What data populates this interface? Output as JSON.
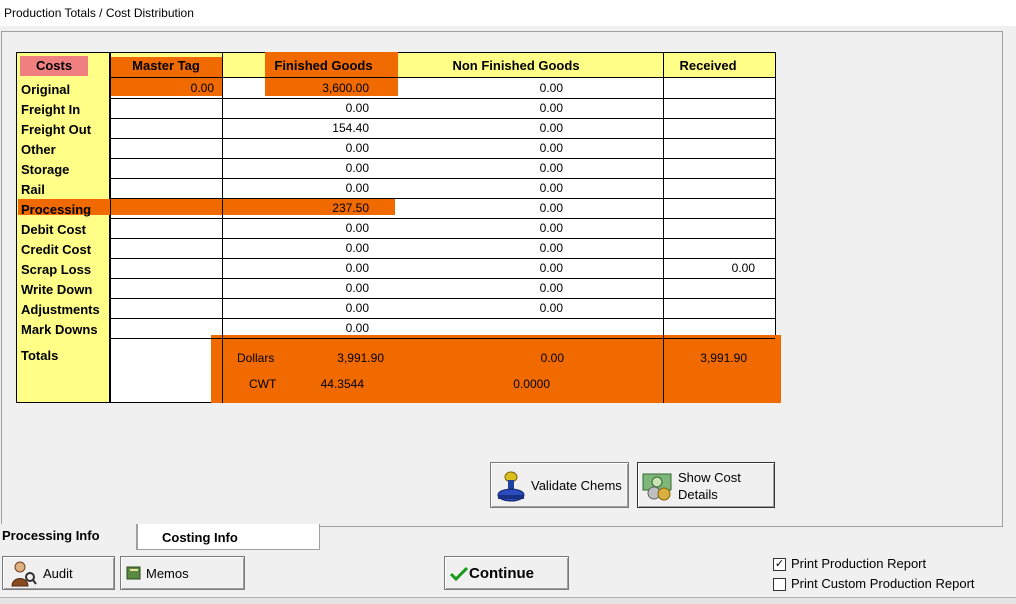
{
  "window": {
    "title": "Production Totals / Cost Distribution"
  },
  "headers": {
    "costs": "Costs",
    "master_tag": "Master Tag",
    "finished_goods": "Finished Goods",
    "non_finished_goods": "Non Finished Goods",
    "received": "Received"
  },
  "rows": [
    {
      "label": "Original",
      "master": "0.00",
      "fg": "3,600.00",
      "nfg": "0.00",
      "rec": ""
    },
    {
      "label": "Freight In",
      "master": "",
      "fg": "0.00",
      "nfg": "0.00",
      "rec": ""
    },
    {
      "label": "Freight Out",
      "master": "",
      "fg": "154.40",
      "nfg": "0.00",
      "rec": ""
    },
    {
      "label": "Other",
      "master": "",
      "fg": "0.00",
      "nfg": "0.00",
      "rec": ""
    },
    {
      "label": "Storage",
      "master": "",
      "fg": "0.00",
      "nfg": "0.00",
      "rec": ""
    },
    {
      "label": "Rail",
      "master": "",
      "fg": "0.00",
      "nfg": "0.00",
      "rec": ""
    },
    {
      "label": "Processing",
      "master": "",
      "fg": "237.50",
      "nfg": "0.00",
      "rec": ""
    },
    {
      "label": "Debit Cost",
      "master": "",
      "fg": "0.00",
      "nfg": "0.00",
      "rec": ""
    },
    {
      "label": "Credit Cost",
      "master": "",
      "fg": "0.00",
      "nfg": "0.00",
      "rec": ""
    },
    {
      "label": "Scrap Loss",
      "master": "",
      "fg": "0.00",
      "nfg": "0.00",
      "rec": "0.00"
    },
    {
      "label": "Write Down",
      "master": "",
      "fg": "0.00",
      "nfg": "0.00",
      "rec": ""
    },
    {
      "label": "Adjustments",
      "master": "",
      "fg": "0.00",
      "nfg": "0.00",
      "rec": ""
    },
    {
      "label": "Mark Downs",
      "master": "",
      "fg": "0.00",
      "nfg": "",
      "rec": ""
    }
  ],
  "totals": {
    "label": "Totals",
    "dollars_label": "Dollars",
    "dollars_fg": "3,991.90",
    "dollars_nfg": "0.00",
    "dollars_rec": "3,991.90",
    "cwt_label": "CWT",
    "cwt_fg": "44.3544",
    "cwt_nfg": "0.0000"
  },
  "buttons": {
    "validate_chems": "Validate Chems",
    "show_cost_details_1": "Show Cost",
    "show_cost_details_2": "Details",
    "audit": "Audit",
    "memos": "Memos",
    "continue": "Continue"
  },
  "tabs": {
    "processing_info": "Processing Info",
    "costing_info": "Costing Info"
  },
  "checkboxes": {
    "print_production_report": {
      "label": "Print Production Report",
      "checked": true
    },
    "print_custom_production_report": {
      "label": "Print Custom Production Report",
      "checked": false
    }
  },
  "colors": {
    "highlight": "#f06a00",
    "yellow": "#ffff88",
    "costs_header_bg": "#f08080",
    "check_green": "#1a9a1a"
  }
}
